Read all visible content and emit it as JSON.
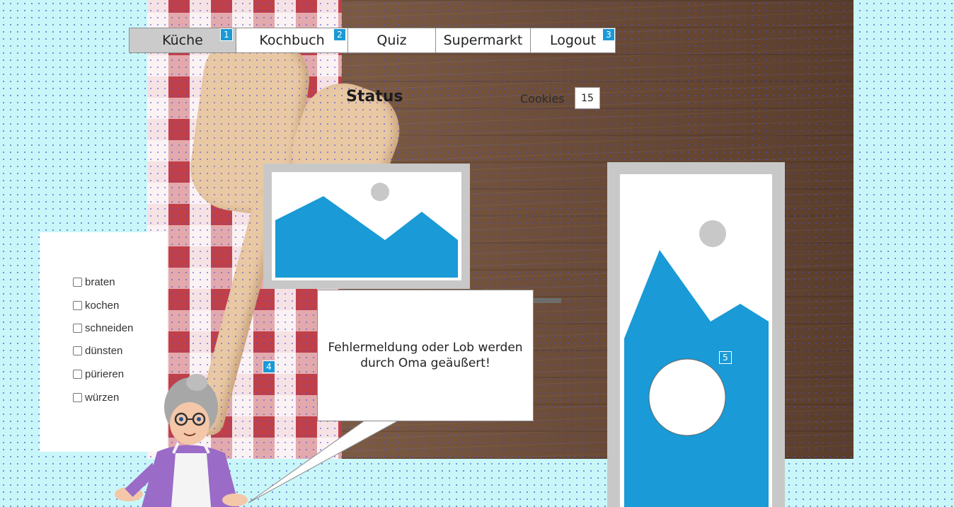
{
  "nav": {
    "items": [
      {
        "label": "Küche",
        "badge": "1"
      },
      {
        "label": "Kochbuch",
        "badge": "2"
      },
      {
        "label": "Quiz",
        "badge": ""
      },
      {
        "label": "Supermarkt",
        "badge": ""
      },
      {
        "label": "Logout",
        "badge": "3"
      }
    ]
  },
  "status": {
    "title": "Status",
    "cookies_label": "Cookies",
    "cookies_value": "15"
  },
  "checkboxes": [
    "braten",
    "kochen",
    "schneiden",
    "dünsten",
    "pürieren",
    "würzen"
  ],
  "speech_bubble": {
    "text": "Fehlermeldung oder Lob werden durch Oma geäußert!"
  },
  "markers": {
    "grandma": "4",
    "side_image": "5"
  },
  "colors": {
    "accent": "#1a9ad6",
    "placeholder_gray": "#c8c8c8",
    "active_nav": "#cbcbcb"
  },
  "icons": {
    "arrow": "arrow-left-icon",
    "image_placeholder": "image-placeholder-icon"
  }
}
